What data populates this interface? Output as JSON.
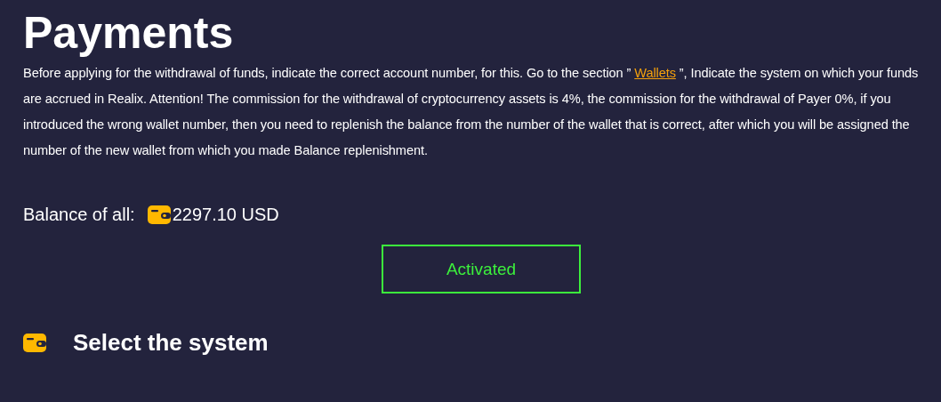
{
  "page": {
    "title": "Payments"
  },
  "notice": {
    "before": "Before applying for the withdrawal of funds, indicate the correct account number, for this. Go to the section ” ",
    "link": "Wallets",
    "after": " ”, Indicate the system on which your funds are accrued in Realix. Attention! The commission for the withdrawal of cryptocurrency assets is 4%, the commission for the withdrawal of Payer 0%, if you introduced the wrong wallet number, then you need to replenish the balance from the number of the wallet that is correct, after which you will be assigned the number of the new wallet from which you made Balance replenishment."
  },
  "balance": {
    "label": "Balance of all:",
    "amount": "2297.10 USD"
  },
  "status_button": {
    "label": "Activated",
    "active": true
  },
  "section": {
    "title": "Select the system"
  }
}
